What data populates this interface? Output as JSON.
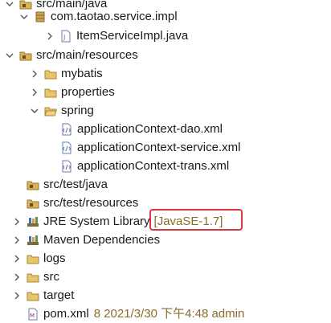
{
  "tree": {
    "items": [
      {
        "label": "src/main/java",
        "decor": "",
        "meta": ""
      },
      {
        "label": "com.taotao.service.impl",
        "decor": "",
        "meta": ""
      },
      {
        "label": "ItemServiceImpl.java",
        "decor": "",
        "meta": ""
      },
      {
        "label": "src/main/resources",
        "decor": "",
        "meta": ""
      },
      {
        "label": "mybatis",
        "decor": "",
        "meta": ""
      },
      {
        "label": "properties",
        "decor": "",
        "meta": ""
      },
      {
        "label": "spring",
        "decor": "",
        "meta": ""
      },
      {
        "label": "applicationContext-dao.xml",
        "decor": "",
        "meta": ""
      },
      {
        "label": "applicationContext-service.xml",
        "decor": "",
        "meta": ""
      },
      {
        "label": "applicationContext-trans.xml",
        "decor": "",
        "meta": ""
      },
      {
        "label": "src/test/java",
        "decor": "",
        "meta": ""
      },
      {
        "label": "src/test/resources",
        "decor": "",
        "meta": ""
      },
      {
        "label": "JRE System Library",
        "decor": "[JavaSE-1.7]",
        "meta": ""
      },
      {
        "label": "Maven Dependencies",
        "decor": "",
        "meta": ""
      },
      {
        "label": "logs",
        "decor": "",
        "meta": ""
      },
      {
        "label": "src",
        "decor": "",
        "meta": ""
      },
      {
        "label": "target",
        "decor": "",
        "meta": ""
      },
      {
        "label": "pom.xml",
        "decor": "",
        "meta": "8  2021/3/30 下午4:48  admin"
      }
    ]
  },
  "colors": {
    "folder": "#d8b35a",
    "package": "#b08a3a",
    "highlight": "#d9363e",
    "decor_text": "#8a6d2a"
  }
}
